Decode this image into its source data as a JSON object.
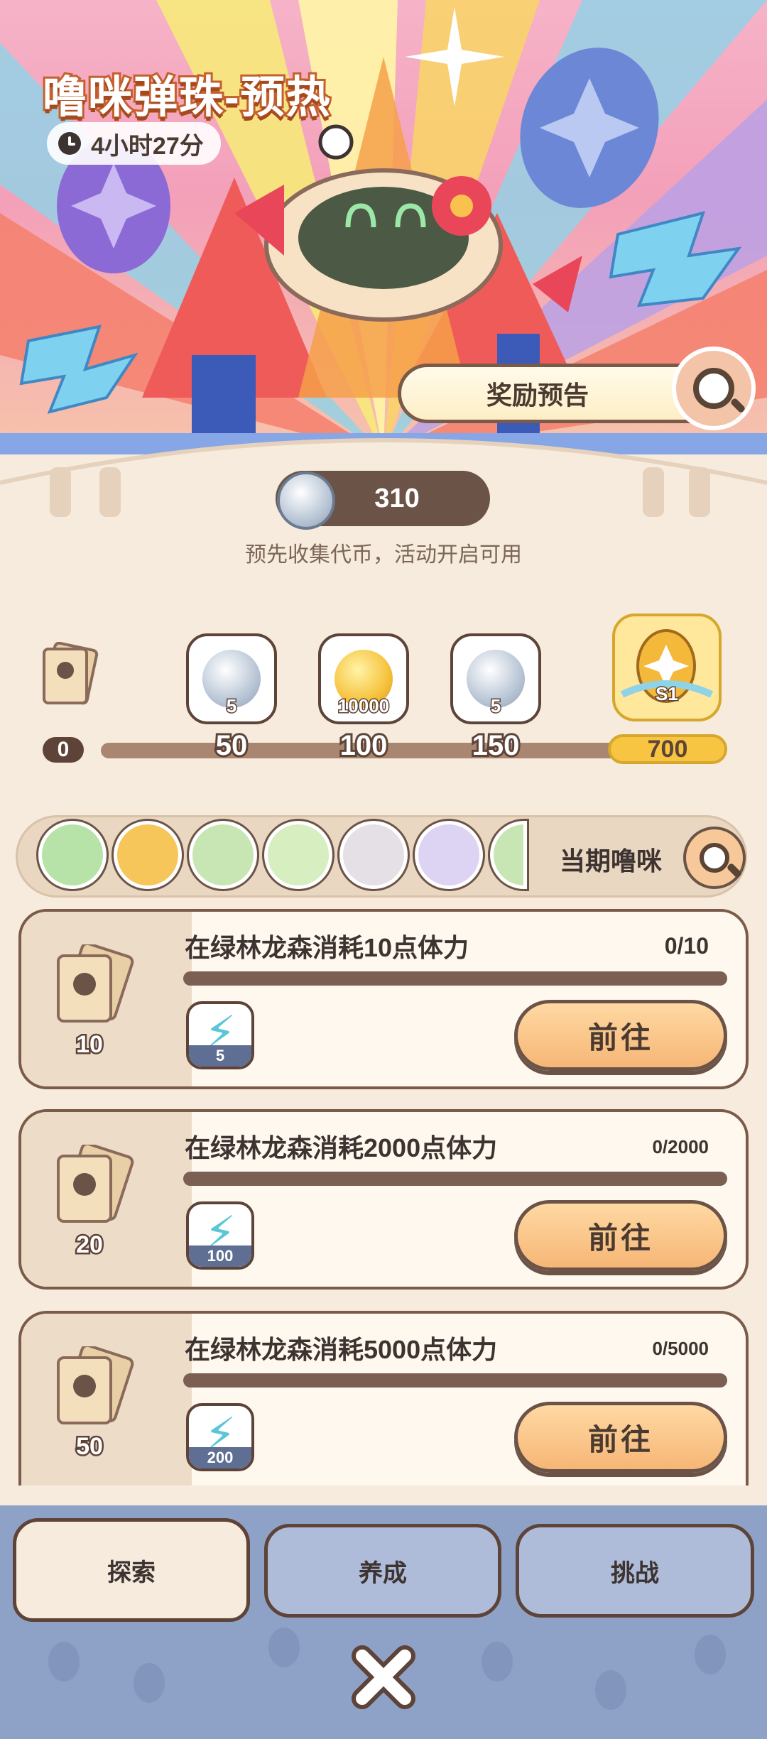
{
  "header": {
    "title": "噜咪弹珠-预热",
    "timer": "4小时27分",
    "reward_button": "奖励预告"
  },
  "currency": {
    "amount": "310",
    "hint": "预先收集代币，活动开启可用"
  },
  "milestones": {
    "start": "0",
    "items": [
      {
        "threshold": "50",
        "reward_qty": "5",
        "reward_icon": "silver-coin-icon"
      },
      {
        "threshold": "100",
        "reward_qty": "10000",
        "reward_icon": "gold-coin-icon"
      },
      {
        "threshold": "150",
        "reward_qty": "5",
        "reward_icon": "silver-coin-icon"
      },
      {
        "threshold": "700",
        "reward_qty": "S1",
        "reward_icon": "egg-icon"
      }
    ]
  },
  "pets": {
    "label": "当期噜咪",
    "icons": [
      "green-bear-icon",
      "orange-beast-icon",
      "green-dragon-icon",
      "green-fox-icon",
      "panda-cat-icon",
      "purple-sheep-icon",
      "green-cat-icon"
    ]
  },
  "tasks": [
    {
      "title": "在绿林龙森消耗10点体力",
      "progress": "0/10",
      "ticket_qty": "10",
      "energy_qty": "5",
      "button": "前往"
    },
    {
      "title": "在绿林龙森消耗2000点体力",
      "progress": "0/2000",
      "ticket_qty": "20",
      "energy_qty": "100",
      "button": "前往"
    },
    {
      "title": "在绿林龙森消耗5000点体力",
      "progress": "0/5000",
      "ticket_qty": "50",
      "energy_qty": "200",
      "button": "前往"
    }
  ],
  "tabs": [
    "探索",
    "养成",
    "挑战"
  ],
  "colors": {
    "accent": "#f6b676",
    "brown": "#5e4338",
    "tab_bar": "#8ea2c8"
  }
}
